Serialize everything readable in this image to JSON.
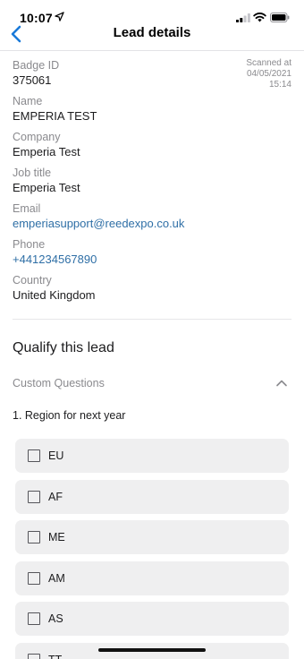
{
  "status_bar": {
    "time": "10:07"
  },
  "nav": {
    "title": "Lead details"
  },
  "lead": {
    "badge_label": "Badge ID",
    "badge_value": "375061",
    "scanned_label": "Scanned at",
    "scanned_date": "04/05/2021",
    "scanned_time": "15:14",
    "name_label": "Name",
    "name_value": "EMPERIA TEST",
    "company_label": "Company",
    "company_value": "Emperia Test",
    "job_label": "Job title",
    "job_value": "Emperia Test",
    "email_label": "Email",
    "email_value": "emperiasupport@reedexpo.co.uk",
    "phone_label": "Phone",
    "phone_value": "+441234567890",
    "country_label": "Country",
    "country_value": "United Kingdom"
  },
  "qualify": {
    "title": "Qualify this lead",
    "section_label": "Custom Questions",
    "question": "1. Region for next year",
    "options": [
      {
        "label": "EU",
        "checked": false
      },
      {
        "label": "AF",
        "checked": false
      },
      {
        "label": "ME",
        "checked": false
      },
      {
        "label": "AM",
        "checked": false
      },
      {
        "label": "AS",
        "checked": false
      },
      {
        "label": "TT",
        "checked": false
      }
    ]
  },
  "colors": {
    "link": "#2f6fa6",
    "accent": "#1a7ad9",
    "option_bg": "#efeff0"
  }
}
